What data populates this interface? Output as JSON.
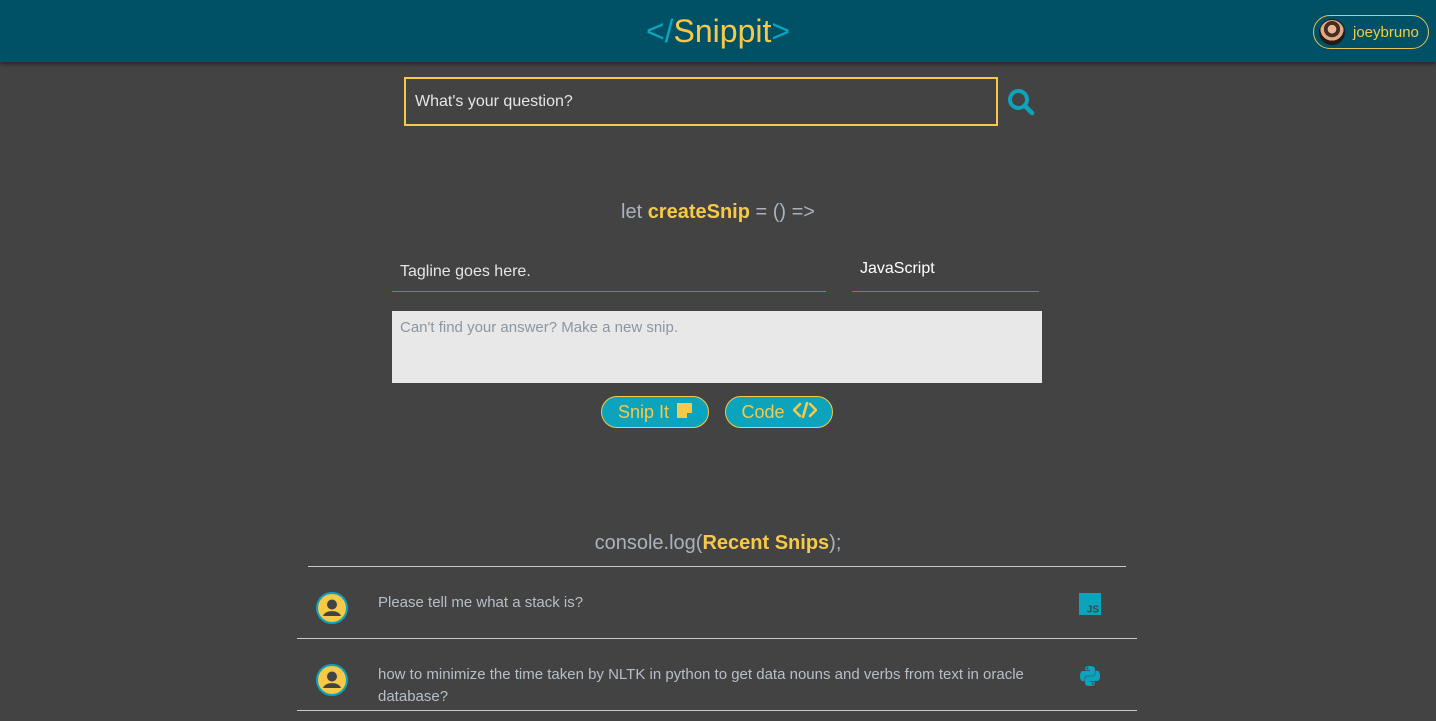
{
  "header": {
    "logo_open": "</",
    "logo_name": "Snippit",
    "logo_close": ">",
    "username": "joeybruno"
  },
  "search": {
    "placeholder": "What's your question?"
  },
  "create": {
    "heading_prefix": "let ",
    "heading_name": "createSnip",
    "heading_suffix": " = () =>",
    "tagline_placeholder": "Tagline goes here.",
    "language": "JavaScript",
    "body_placeholder": "Can't find your answer? Make a new snip.",
    "snip_button": "Snip It",
    "code_button": "Code"
  },
  "recent": {
    "heading_prefix": "console.log(",
    "heading_name": "Recent Snips",
    "heading_suffix": ");",
    "items": [
      {
        "text": "Please tell me what a stack is?",
        "language_icon": "javascript-icon"
      },
      {
        "text": "how to minimize the time taken by NLTK in python to get data nouns and verbs from text in oracle database?",
        "language_icon": "python-icon"
      }
    ]
  },
  "colors": {
    "background": "#434343",
    "header": "#005166",
    "accent_yellow": "#f7c948",
    "accent_teal": "#0ba4bc"
  }
}
